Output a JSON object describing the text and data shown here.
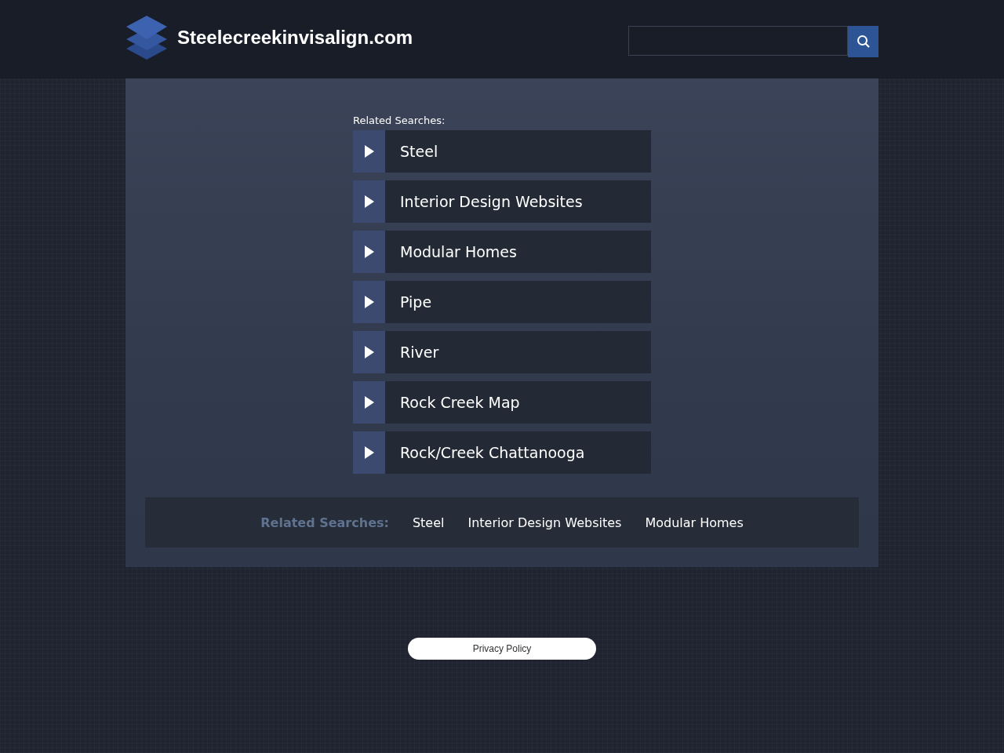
{
  "header": {
    "site_name": "Steelecreekinvisalign.com"
  },
  "related": {
    "heading": "Related Searches:",
    "items": [
      "Steel",
      "Interior Design Websites",
      "Modular Homes",
      "Pipe",
      "River",
      "Rock Creek Map",
      "Rock/Creek Chattanooga"
    ]
  },
  "footer_bar": {
    "heading": "Related Searches:",
    "links": [
      "Steel",
      "Interior Design Websites",
      "Modular Homes"
    ]
  },
  "privacy": "Privacy Policy"
}
